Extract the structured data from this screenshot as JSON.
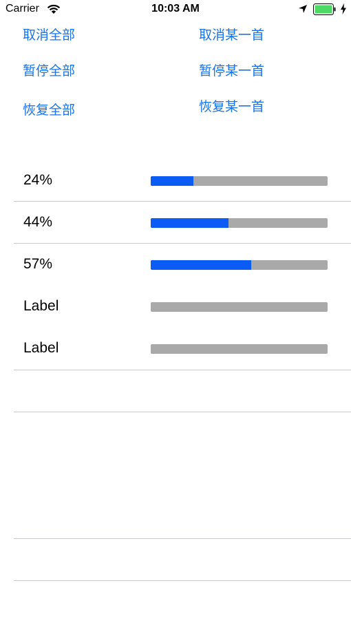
{
  "status_bar": {
    "carrier": "Carrier",
    "time": "10:03 AM",
    "battery_color": "#4cd964"
  },
  "controls": {
    "cancel_all": "取消全部",
    "cancel_one": "取消某一首",
    "pause_all": "暂停全部",
    "pause_one": "暂停某一首",
    "resume_all": "恢复全部",
    "resume_one": "恢复某一首"
  },
  "accent_color": "#1a73e8",
  "progress_color": "#0a5cf5",
  "track_color": "#a9a9a9",
  "downloads": [
    {
      "label": "24%",
      "progress": 0.24
    },
    {
      "label": "44%",
      "progress": 0.44
    },
    {
      "label": "57%",
      "progress": 0.57
    },
    {
      "label": "Label",
      "progress": 0
    },
    {
      "label": "Label",
      "progress": 0
    }
  ]
}
